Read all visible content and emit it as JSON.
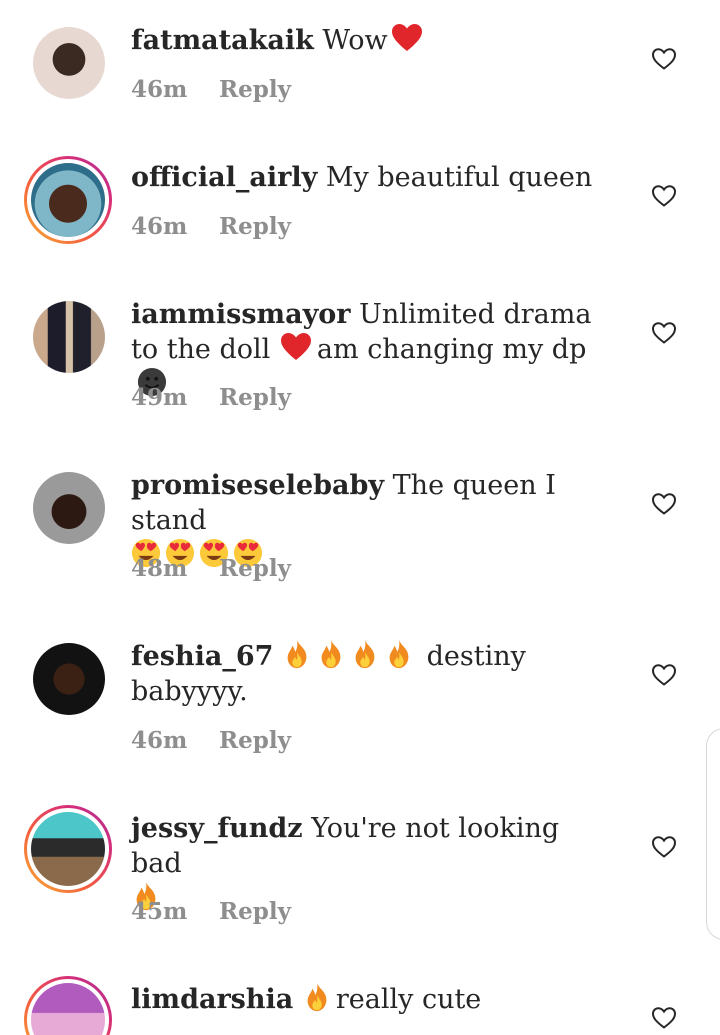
{
  "comments": [
    {
      "username": "fatmatakaik",
      "text": "Wow",
      "emoji_after": [
        "heart"
      ],
      "time": "46m",
      "reply": "Reply"
    },
    {
      "username": "official_airly",
      "text": "My beautiful queen",
      "time": "46m",
      "reply": "Reply"
    },
    {
      "username": "iammissmayor",
      "text": "Unlimited drama to the doll",
      "text2": "am changing my dp",
      "time": "49m",
      "reply": "Reply"
    },
    {
      "username": "promiseselebaby",
      "text": "The queen I stand",
      "time": "48m",
      "reply": "Reply"
    },
    {
      "username": "feshia_67",
      "text": "destiny babyyyy.",
      "time": "46m",
      "reply": "Reply"
    },
    {
      "username": "jessy_fundz",
      "text": "You're not looking bad",
      "time": "45m",
      "reply": "Reply"
    },
    {
      "username": "limdarshia",
      "text": "really cute",
      "time": "",
      "reply": ""
    }
  ],
  "colors": {
    "text": "#262626",
    "meta": "#8e8e8e",
    "heart": "#e0262b",
    "ring_start": "#f9b233",
    "ring_end": "#a52f9a"
  },
  "icons": {
    "like": "heart-outline-icon"
  }
}
